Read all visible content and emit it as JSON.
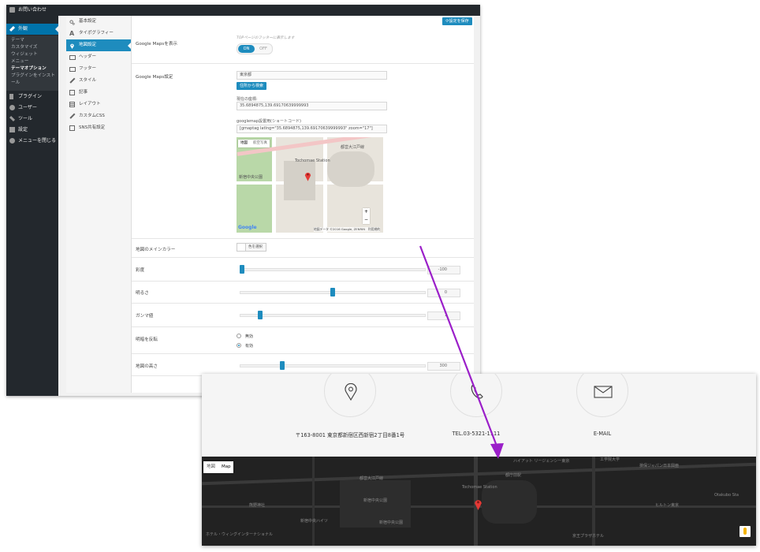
{
  "wp_menu": {
    "top_label": "お問い合わせ",
    "appearance": "外観",
    "submenu": [
      "テーマ",
      "カスタマイズ",
      "ウィジェット",
      "メニュー",
      "テーマオプション",
      "プラグインをインストール"
    ],
    "items": [
      "プラグイン",
      "ユーザー",
      "ツール",
      "設定",
      "メニューを閉じる"
    ]
  },
  "tabs": [
    "基本設定",
    "タイポグラフィー",
    "地図設定",
    "ヘッダー",
    "フッター",
    "スタイル",
    "記事",
    "レイアウト",
    "カスタムCSS",
    "SNS共有設定"
  ],
  "save_label": "設定を保存",
  "show_maps": {
    "label": "Google Mapsを表示",
    "hint": "TOPページのフッターに表示します",
    "on": "ON",
    "off": "OFF"
  },
  "maps_settings": {
    "label": "Google Maps設定",
    "address": "東京都",
    "search_button": "住所から検索",
    "latlng_label": "現在の座標:",
    "latlng_value": "35.6894875,139.69170639999993",
    "shortcode_label": "googlemap設置用(ショートコード)",
    "shortcode_value": "[gmaptag latlng=\"35.6894875,139.69170639999993\" zoom=\"17\"]",
    "map_tab_map": "地図",
    "map_tab_sat": "航空写真",
    "map_footer": "地図データ ©2016 Google, ZENRIN　利用規約",
    "map_station": "Tochomae Station",
    "map_station_jp": "都庁前駅",
    "map_line": "都営大江戸線",
    "map_park": "新宿中央公園",
    "google_logo": "Google"
  },
  "main_color": {
    "label": "地図のメインカラー",
    "button": "色を選択"
  },
  "sliders": [
    {
      "label": "彩度",
      "value": -100,
      "display": "-100"
    },
    {
      "label": "明るさ",
      "value": 0,
      "display": "0"
    },
    {
      "label": "ガンマ値",
      "value": 1,
      "display": "1"
    }
  ],
  "invert": {
    "label": "明暗を反転",
    "options": [
      "無効",
      "有効"
    ],
    "selected": "有効"
  },
  "map_height": {
    "label": "地図の高さ",
    "value": 300,
    "display": "300"
  },
  "front": {
    "address": "〒163-8001 東京都新宿区西新宿2丁目8番1号",
    "tel": "TEL.03-5321-1111",
    "email": "E-MAIL",
    "map_toggle_jp": "地図",
    "map_toggle_en": "Map",
    "labels": [
      "東京都庁",
      "新宿中央公園",
      "都営大江戸線",
      "Tochomae Station",
      "新宿ワシントンホテル",
      "京王プラザホテル",
      "ハイアット リージェンシー東京",
      "工学院大学",
      "損保ジャパン日本興亜",
      "熊野神社",
      "新宿中央公園",
      "ヒルトン東京",
      "ホテル・ウィングインターナショナル",
      "新宿中央ハイツ",
      "十二社通り",
      "西新宿",
      "Otakubo Sta",
      "東京医科大学",
      "代々木",
      "新宿三井ビル",
      "都庁前駅"
    ]
  },
  "colors": {
    "accent": "#1e8cbe",
    "admin_dark": "#23282d",
    "arrow": "#9b1fc9",
    "map_pin": "#e53935"
  }
}
